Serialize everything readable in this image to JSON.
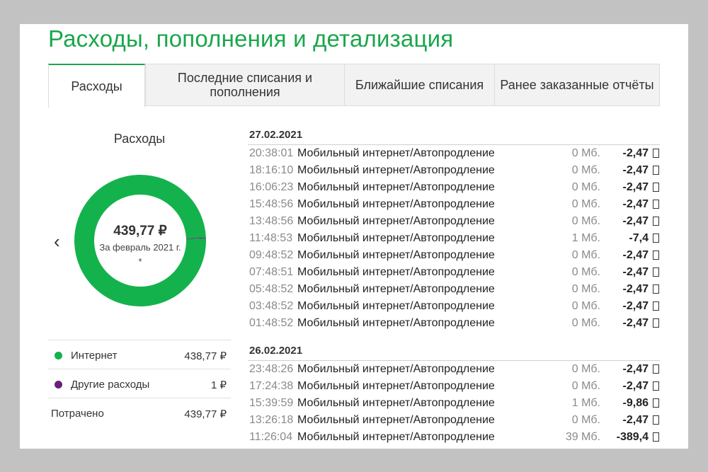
{
  "page": {
    "title": "Расходы, пополнения и детализация"
  },
  "tabs": [
    {
      "label": "Расходы",
      "active": true
    },
    {
      "label": "Последние списания и пополнения"
    },
    {
      "label": "Ближайшие списания"
    },
    {
      "label": "Ранее заказанные отчёты"
    }
  ],
  "summary": {
    "heading": "Расходы",
    "nav_prev_icon": "chevron-left-icon",
    "total": "439,77 ₽",
    "period": "За февраль 2021 г. *",
    "segments": [
      {
        "name": "Интернет",
        "amount": 438.77,
        "color": "#14b24c"
      },
      {
        "name": "Другие расходы",
        "amount": 1,
        "color": "#6a1f7a"
      }
    ],
    "legend": [
      {
        "label": "Интернет",
        "value": "438,77 ₽",
        "color": "#14b24c"
      },
      {
        "label": "Другие расходы",
        "value": "1 ₽",
        "color": "#6a1f7a"
      }
    ],
    "spent_label": "Потрачено",
    "spent_value": "439,77 ₽"
  },
  "operations": [
    {
      "date": "27.02.2021",
      "items": [
        {
          "time": "20:38:01",
          "desc": "Мобильный интернет/Автопродление",
          "volume": "0 Мб.",
          "amount": "-2,47"
        },
        {
          "time": "18:16:10",
          "desc": "Мобильный интернет/Автопродление",
          "volume": "0 Мб.",
          "amount": "-2,47"
        },
        {
          "time": "16:06:23",
          "desc": "Мобильный интернет/Автопродление",
          "volume": "0 Мб.",
          "amount": "-2,47"
        },
        {
          "time": "15:48:56",
          "desc": "Мобильный интернет/Автопродление",
          "volume": "0 Мб.",
          "amount": "-2,47"
        },
        {
          "time": "13:48:56",
          "desc": "Мобильный интернет/Автопродление",
          "volume": "0 Мб.",
          "amount": "-2,47"
        },
        {
          "time": "11:48:53",
          "desc": "Мобильный интернет/Автопродление",
          "volume": "1 Мб.",
          "amount": "-7,4"
        },
        {
          "time": "09:48:52",
          "desc": "Мобильный интернет/Автопродление",
          "volume": "0 Мб.",
          "amount": "-2,47"
        },
        {
          "time": "07:48:51",
          "desc": "Мобильный интернет/Автопродление",
          "volume": "0 Мб.",
          "amount": "-2,47"
        },
        {
          "time": "05:48:52",
          "desc": "Мобильный интернет/Автопродление",
          "volume": "0 Мб.",
          "amount": "-2,47"
        },
        {
          "time": "03:48:52",
          "desc": "Мобильный интернет/Автопродление",
          "volume": "0 Мб.",
          "amount": "-2,47"
        },
        {
          "time": "01:48:52",
          "desc": "Мобильный интернет/Автопродление",
          "volume": "0 Мб.",
          "amount": "-2,47"
        }
      ]
    },
    {
      "date": "26.02.2021",
      "items": [
        {
          "time": "23:48:26",
          "desc": "Мобильный интернет/Автопродление",
          "volume": "0 Мб.",
          "amount": "-2,47"
        },
        {
          "time": "17:24:38",
          "desc": "Мобильный интернет/Автопродление",
          "volume": "0 Мб.",
          "amount": "-2,47"
        },
        {
          "time": "15:39:59",
          "desc": "Мобильный интернет/Автопродление",
          "volume": "1 Мб.",
          "amount": "-9,86"
        },
        {
          "time": "13:26:18",
          "desc": "Мобильный интернет/Автопродление",
          "volume": "0 Мб.",
          "amount": "-2,47"
        },
        {
          "time": "11:26:04",
          "desc": "Мобильный интернет/Автопродление",
          "volume": "39 Мб.",
          "amount": "-389,4"
        }
      ]
    }
  ]
}
